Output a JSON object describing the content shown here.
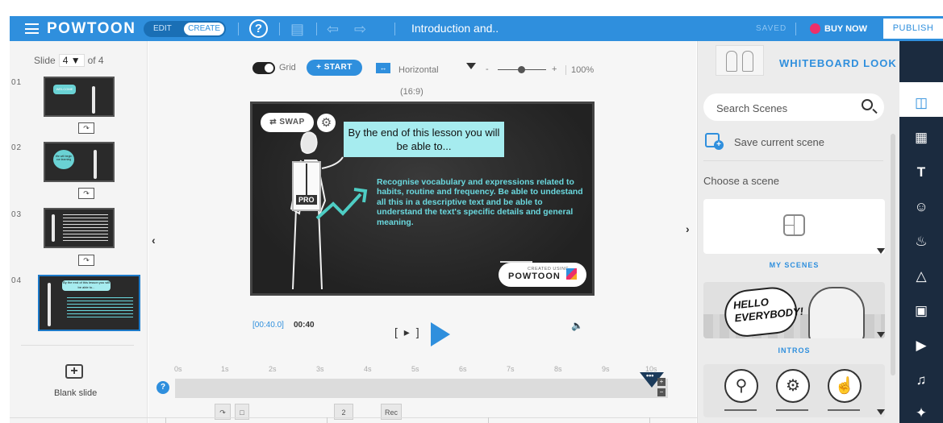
{
  "topbar": {
    "logo": "POWTOON",
    "edit_label": "EDIT",
    "create_label": "CREATE",
    "help_label": "?",
    "title": "Introduction and..",
    "saved_label": "SAVED",
    "buy_now_label": "BUY NOW",
    "publish_label": "PUBLISH"
  },
  "slides_panel": {
    "slide_label": "Slide",
    "current_slide": "4",
    "of_label": "of 4",
    "slides": [
      {
        "number": "01",
        "callout": "WELCOME"
      },
      {
        "number": "02",
        "callout": "We will begin our learning"
      },
      {
        "number": "03",
        "callout": ""
      },
      {
        "number": "04",
        "callout": "By the end of this lesson you will be able to..."
      }
    ],
    "blank_slide_label": "Blank slide"
  },
  "toolbar": {
    "grid_label": "Grid",
    "start_label": "START",
    "orientation_label": "Horizontal",
    "zoom_minus": "-",
    "zoom_plus": "+",
    "zoom_value": "100%",
    "aspect_ratio": "(16:9)"
  },
  "slide": {
    "swap_label": "SWAP",
    "title": "By the end of this lesson you will be able to...",
    "body": "Recognise vocabulary and expressions related to habits, routine and frequency. Be able to undestand all this in a descriptive text and be able to understand the text's specific details and general meaning.",
    "badge": "PRO",
    "created_using": "CREATED USING",
    "created_logo": "POWTOON"
  },
  "player": {
    "time_total": "[00:40.0]",
    "time_current": "00:40",
    "step_play": "[ ▸ ]"
  },
  "timeline": {
    "help_label": "?",
    "ticks": [
      "0s",
      "1s",
      "2s",
      "3s",
      "4s",
      "5s",
      "6s",
      "7s",
      "8s",
      "9s",
      "10s"
    ],
    "marker_label": "•••",
    "chip_2": "2",
    "chip_rec": "Rec"
  },
  "scenes_panel": {
    "look_label": "WHITEBOARD LOOK",
    "search_placeholder": "Search Scenes",
    "save_scene_label": "Save current scene",
    "choose_label": "Choose a scene",
    "categories": [
      {
        "label": "MY SCENES"
      },
      {
        "label": "INTROS",
        "art_text": "HELLO EVERYBODY!"
      }
    ]
  },
  "rail": {
    "icons": [
      "scenes-icon",
      "backgrounds-icon",
      "text-icon",
      "characters-icon",
      "props-icon",
      "shapes-icon",
      "images-icon",
      "video-icon",
      "music-icon",
      "transitions-icon"
    ]
  },
  "colors": {
    "brand_blue": "#2f8fdd",
    "rail_dark": "#1b2b3f",
    "slide_accent": "#6ad8de",
    "buy_now_pink": "#ec2f6a"
  }
}
